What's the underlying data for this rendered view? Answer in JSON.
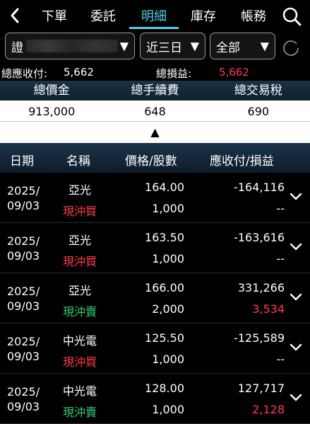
{
  "nav": {
    "tabs": [
      {
        "label": "下單"
      },
      {
        "label": "委託"
      },
      {
        "label": "明細"
      },
      {
        "label": "庫存"
      },
      {
        "label": "帳務"
      }
    ],
    "active_index": 2,
    "accent": "#4fd0ee"
  },
  "filters": {
    "account_prefix": "證",
    "period": "近三日",
    "scope": "全部"
  },
  "summary": {
    "payable_label": "總應收付:",
    "payable_value": "5,662",
    "pl_label": "總損益:",
    "pl_value": "5,662"
  },
  "totals": {
    "headers": [
      "總價金",
      "總手續費",
      "總交易稅"
    ],
    "values": [
      "913,000",
      "648",
      "690"
    ],
    "collapse_glyph": "▲"
  },
  "table": {
    "headers": {
      "date": "日期",
      "name": "名稱",
      "price_qty": "價格/股數",
      "pay_pl": "應收付/損益"
    },
    "rows": [
      {
        "year": "2025/",
        "md": "09/03",
        "name": "亞光",
        "type": "現沖買",
        "side": "buy",
        "price": "164.00",
        "qty": "1,000",
        "payable": "-164,116",
        "pl": "--"
      },
      {
        "year": "2025/",
        "md": "09/03",
        "name": "亞光",
        "type": "現沖買",
        "side": "buy",
        "price": "163.50",
        "qty": "1,000",
        "payable": "-163,616",
        "pl": "--"
      },
      {
        "year": "2025/",
        "md": "09/03",
        "name": "亞光",
        "type": "現沖賣",
        "side": "sell",
        "price": "166.00",
        "qty": "2,000",
        "payable": "331,266",
        "pl": "3,534"
      },
      {
        "year": "2025/",
        "md": "09/03",
        "name": "中光電",
        "type": "現沖買",
        "side": "buy",
        "price": "125.50",
        "qty": "1,000",
        "payable": "-125,589",
        "pl": "--"
      },
      {
        "year": "2025/",
        "md": "09/03",
        "name": "中光電",
        "type": "現沖賣",
        "side": "sell",
        "price": "128.00",
        "qty": "1,000",
        "payable": "127,717",
        "pl": "2,128"
      }
    ]
  }
}
